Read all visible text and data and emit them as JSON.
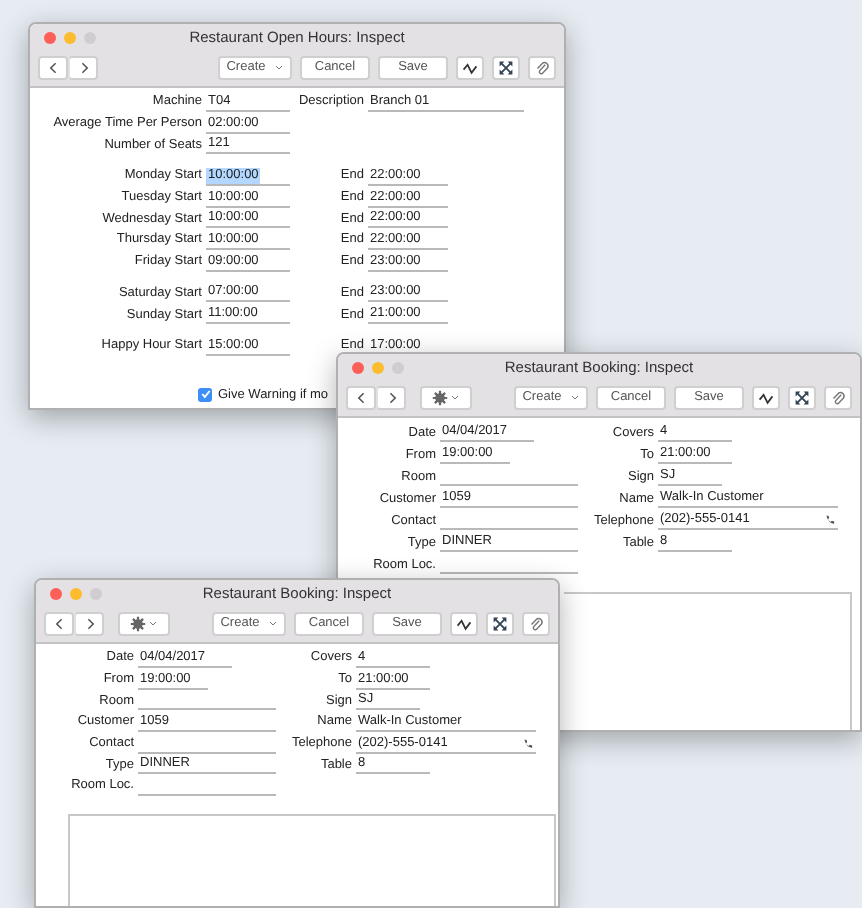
{
  "windows": [
    {
      "title": "Restaurant Open Hours: Inspect",
      "toolbar": [
        {
          "kind": "back"
        },
        {
          "kind": "forward"
        },
        {
          "kind": "spacer"
        },
        {
          "kind": "menu",
          "label": "Create"
        },
        {
          "kind": "text",
          "label": "Cancel"
        },
        {
          "kind": "text",
          "label": "Save"
        },
        {
          "kind": "wave"
        },
        {
          "kind": "expand"
        },
        {
          "kind": "clip"
        }
      ],
      "sections": [
        [
          {
            "left": {
              "label": "Machine",
              "value": "T04",
              "selected": false
            },
            "right": {
              "label": "Description",
              "value": "Branch 01",
              "selected": false
            }
          },
          {
            "left": {
              "label": "Average Time Per Person",
              "value": "02:00:00",
              "selected": false
            }
          },
          {
            "left": {
              "label": "Number of Seats",
              "value": "121",
              "selected": false
            }
          }
        ],
        [
          {
            "left": {
              "label": "Monday Start",
              "value": "10:00:00",
              "selected": true
            },
            "right": {
              "label": "End",
              "value": "22:00:00",
              "selected": false
            }
          },
          {
            "left": {
              "label": "Tuesday Start",
              "value": "10:00:00",
              "selected": false
            },
            "right": {
              "label": "End",
              "value": "22:00:00",
              "selected": false
            }
          },
          {
            "left": {
              "label": "Wednesday Start",
              "value": "10:00:00",
              "selected": false
            },
            "right": {
              "label": "End",
              "value": "22:00:00",
              "selected": false
            }
          },
          {
            "left": {
              "label": "Thursday Start",
              "value": "10:00:00",
              "selected": false
            },
            "right": {
              "label": "End",
              "value": "22:00:00",
              "selected": false
            }
          },
          {
            "left": {
              "label": "Friday Start",
              "value": "09:00:00",
              "selected": false
            },
            "right": {
              "label": "End",
              "value": "23:00:00",
              "selected": false
            }
          }
        ],
        [
          {
            "left": {
              "label": "Saturday Start",
              "value": "07:00:00",
              "selected": false
            },
            "right": {
              "label": "End",
              "value": "23:00:00",
              "selected": false
            }
          },
          {
            "left": {
              "label": "Sunday Start",
              "value": "11:00:00",
              "selected": false
            },
            "right": {
              "label": "End",
              "value": "21:00:00",
              "selected": false
            }
          }
        ],
        [
          {
            "left": {
              "label": "Happy Hour Start",
              "value": "15:00:00",
              "selected": false
            },
            "right": {
              "label": "End",
              "value": "17:00:00",
              "selected": false
            }
          }
        ]
      ],
      "checkbox": {
        "label": "Give Warning if mo",
        "checked": true
      }
    },
    {
      "title": "Restaurant Booking: Inspect",
      "toolbar": [
        {
          "kind": "back"
        },
        {
          "kind": "forward"
        },
        {
          "kind": "gear"
        },
        {
          "kind": "spacer"
        },
        {
          "kind": "menu",
          "label": "Create"
        },
        {
          "kind": "text",
          "label": "Cancel"
        },
        {
          "kind": "text",
          "label": "Save"
        },
        {
          "kind": "wave"
        },
        {
          "kind": "expand"
        },
        {
          "kind": "clip"
        }
      ],
      "sections": [
        [
          {
            "left": {
              "label": "Date",
              "value": "04/04/2017"
            },
            "right": {
              "label": "Covers",
              "value": "4"
            }
          },
          {
            "left": {
              "label": "From",
              "value": "19:00:00"
            },
            "right": {
              "label": "To",
              "value": "21:00:00"
            }
          },
          {
            "left": {
              "label": "Room"
            },
            "right": {
              "label": "Sign",
              "value": "SJ"
            }
          },
          {
            "left": {
              "label": "Customer",
              "value": "1059"
            },
            "right": {
              "label": "Name",
              "value": "Walk-In Customer"
            }
          },
          {
            "left": {
              "label": "Contact"
            },
            "right": {
              "label": "Telephone",
              "value": "(202)-555-0141",
              "dial_button": true
            }
          },
          {
            "left": {
              "label": "Type",
              "value": "DINNER"
            },
            "right": {
              "label": "Table",
              "value": "8"
            }
          },
          {
            "left": {
              "label": "Room Loc."
            }
          }
        ]
      ]
    },
    {
      "title": "Restaurant Booking: Inspect",
      "toolbar": [
        {
          "kind": "back"
        },
        {
          "kind": "forward"
        },
        {
          "kind": "gear"
        },
        {
          "kind": "spacer"
        },
        {
          "kind": "menu",
          "label": "Create"
        },
        {
          "kind": "text",
          "label": "Cancel"
        },
        {
          "kind": "text",
          "label": "Save"
        },
        {
          "kind": "wave"
        },
        {
          "kind": "expand"
        },
        {
          "kind": "clip"
        }
      ],
      "sections": [
        [
          {
            "left": {
              "label": "Date",
              "value": "04/04/2017"
            },
            "right": {
              "label": "Covers",
              "value": "4"
            }
          },
          {
            "left": {
              "label": "From",
              "value": "19:00:00"
            },
            "right": {
              "label": "To",
              "value": "21:00:00"
            }
          },
          {
            "left": {
              "label": "Room"
            },
            "right": {
              "label": "Sign",
              "value": "SJ"
            }
          },
          {
            "left": {
              "label": "Customer",
              "value": "1059"
            },
            "right": {
              "label": "Name",
              "value": "Walk-In Customer"
            }
          },
          {
            "left": {
              "label": "Contact"
            },
            "right": {
              "label": "Telephone",
              "value": "(202)-555-0141",
              "dial_button": true
            }
          },
          {
            "left": {
              "label": "Type",
              "value": "DINNER"
            },
            "right": {
              "label": "Table",
              "value": "8"
            }
          },
          {
            "left": {
              "label": "Room Loc."
            }
          }
        ]
      ]
    }
  ]
}
